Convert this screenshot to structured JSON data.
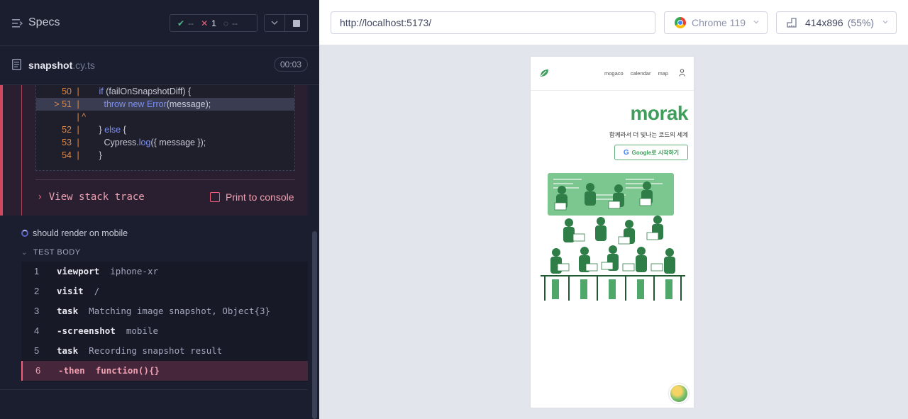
{
  "specs": {
    "title": "Specs",
    "stats": {
      "passed": "--",
      "failed": "1",
      "pending": "--"
    }
  },
  "file": {
    "name": "snapshot",
    "ext": ".cy.ts",
    "duration": "00:03"
  },
  "code_frame": {
    "lines": [
      {
        "num": "50",
        "marker": "",
        "code": "if (failOnSnapshotDiff) {"
      },
      {
        "num": "51",
        "marker": ">",
        "code": "throw new Error(message);"
      },
      {
        "num": "",
        "marker": "",
        "code": "^"
      },
      {
        "num": "52",
        "marker": "",
        "code": "} else {"
      },
      {
        "num": "53",
        "marker": "",
        "code": "Cypress.log({ message });"
      },
      {
        "num": "54",
        "marker": "",
        "code": "}"
      }
    ]
  },
  "error_actions": {
    "view_stack": "View stack trace",
    "print_console": "Print to console"
  },
  "test": {
    "title": "should render on mobile",
    "body_label": "TEST BODY",
    "commands": [
      {
        "num": "1",
        "name": "viewport",
        "message": "iphone-xr",
        "failed": false
      },
      {
        "num": "2",
        "name": "visit",
        "message": "/",
        "failed": false
      },
      {
        "num": "3",
        "name": "task",
        "message": "Matching image snapshot, Object{3}",
        "failed": false
      },
      {
        "num": "4",
        "name": "-screenshot",
        "message": "mobile",
        "failed": false
      },
      {
        "num": "5",
        "name": "task",
        "message": "Recording snapshot result",
        "failed": false
      },
      {
        "num": "6",
        "name": "-then",
        "message": "function(){}",
        "failed": true
      }
    ]
  },
  "browser_bar": {
    "url": "http://localhost:5173/",
    "browser": "Chrome 119",
    "viewport": "414x896",
    "scale": "(55%)"
  },
  "app": {
    "nav": [
      "mogaco",
      "calendar",
      "map"
    ],
    "brand": "morak",
    "tagline": "함께라서 더 빛나는 코드의 세계",
    "google_button": "Google로 시작하기",
    "g_letter": "G"
  },
  "colors": {
    "fail": "#f0607a",
    "pass": "#4fb38b",
    "brand_green": "#3f9e5c",
    "panel_bg": "#1b1e2e"
  }
}
